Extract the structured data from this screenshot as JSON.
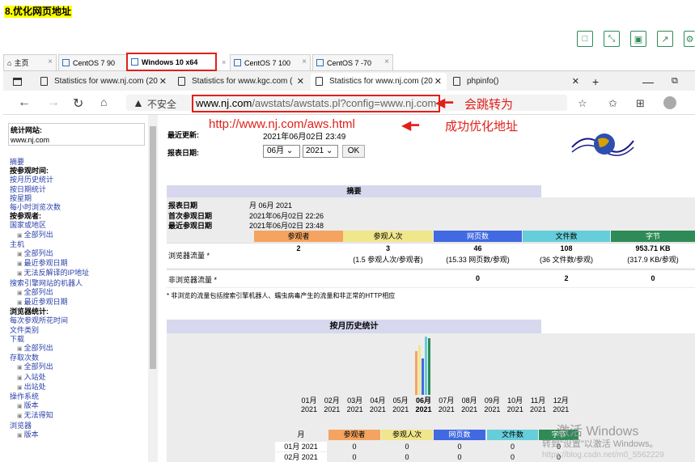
{
  "heading": "8.优化网页地址",
  "toolbar_icons": [
    "square-icon",
    "expand-icon",
    "save-icon",
    "share-icon",
    "settings-icon"
  ],
  "vm_tabs": [
    {
      "label": "主页"
    },
    {
      "label": "CentOS 7 90"
    },
    {
      "label": "Windows 10 x64"
    },
    {
      "label": "CentOS 7 100"
    },
    {
      "label": "CentOS 7 -70"
    }
  ],
  "browser_tabs": [
    {
      "label": "Statistics for www.nj.com (20"
    },
    {
      "label": "Statistics for www.kgc.com ("
    },
    {
      "label": "Statistics for www.nj.com (20"
    },
    {
      "label": "phpinfo()"
    }
  ],
  "address": {
    "security": "不安全",
    "domain": "www.nj.com",
    "path": "/awstats/awstats.pl?config=www.nj.com"
  },
  "annotations": {
    "redirect_note": "会跳转为",
    "new_url": "http://www.nj.com/aws.html",
    "success_note": "成功优化地址"
  },
  "sidebar": {
    "site_label": "统计网站:",
    "site_value": "www.nj.com",
    "items": [
      {
        "text": "摘要",
        "t": "lk"
      },
      {
        "text": "按参观时间:",
        "t": "h"
      },
      {
        "text": "按月历史统计",
        "t": "lk"
      },
      {
        "text": "按日期统计",
        "t": "lk"
      },
      {
        "text": "按星期",
        "t": "lk"
      },
      {
        "text": "每小时浏览次数",
        "t": "lk"
      },
      {
        "text": "按参观者:",
        "t": "h"
      },
      {
        "text": "国家或地区",
        "t": "lk"
      },
      {
        "text": "全部列出",
        "t": "sub"
      },
      {
        "text": "主机",
        "t": "lk"
      },
      {
        "text": "全部列出",
        "t": "sub"
      },
      {
        "text": "最近参观日期",
        "t": "sub"
      },
      {
        "text": "无法反解译的IP地址",
        "t": "sub"
      },
      {
        "text": "搜索引擎网站的机器人",
        "t": "lk"
      },
      {
        "text": "全部列出",
        "t": "sub"
      },
      {
        "text": "最近参观日期",
        "t": "sub"
      },
      {
        "text": "浏览器统计:",
        "t": "h"
      },
      {
        "text": "每次参观所花时间",
        "t": "lk"
      },
      {
        "text": "文件类别",
        "t": "lk"
      },
      {
        "text": "下载",
        "t": "lk"
      },
      {
        "text": "全部列出",
        "t": "sub"
      },
      {
        "text": "存取次数",
        "t": "lk"
      },
      {
        "text": "全部列出",
        "t": "sub"
      },
      {
        "text": "入站处",
        "t": "sub"
      },
      {
        "text": "出站处",
        "t": "sub"
      },
      {
        "text": "操作系统",
        "t": "lk"
      },
      {
        "text": "版本",
        "t": "sub"
      },
      {
        "text": "无法得知",
        "t": "sub"
      },
      {
        "text": "浏览器",
        "t": "lk"
      },
      {
        "text": "版本",
        "t": "sub"
      }
    ]
  },
  "header": {
    "last_update_label": "最近更新:",
    "last_update_value": "2021年06月02日 23:49",
    "report_date_label": "报表日期:",
    "month_select": "06月",
    "year_select": "2021",
    "ok_button": "OK"
  },
  "summary": {
    "title": "摘要",
    "report_date_label": "报表日期",
    "report_date_value": "月 06月 2021",
    "first_visit_label": "首次参观日期",
    "first_visit_value": "2021年06月02日 22:26",
    "last_visit_label": "最近参观日期",
    "last_visit_value": "2021年06月02日 23:48",
    "columns": [
      "参观者",
      "参观人次",
      "网页数",
      "文件数",
      "字节"
    ],
    "column_colors": [
      "#f4a460",
      "#f0e68c",
      "#4169e1",
      "#66cdda",
      "#2e8b57"
    ],
    "rows": [
      {
        "label": "浏览器流量 *",
        "values": [
          "2",
          "3",
          "46",
          "108",
          "953.71 KB"
        ],
        "subs": [
          "",
          "(1.5 参观人次/参观者)",
          "(15.33 网页数/参观)",
          "(36 文件数/参观)",
          "(317.9 KB/参观)"
        ]
      },
      {
        "label": "非浏览器流量 *",
        "values": [
          "",
          "",
          "0",
          "2",
          "0"
        ],
        "subs": [
          "",
          "",
          "",
          "",
          ""
        ]
      }
    ],
    "footnote": "* 非浏览的流量包括搜索引擎机器人、蠕虫病毒产生的流量和非正常的HTTP相应"
  },
  "monthly": {
    "title": "按月历史统计",
    "months": [
      "01月",
      "02月",
      "03月",
      "04月",
      "05月",
      "06月",
      "07月",
      "08月",
      "09月",
      "10月",
      "11月",
      "12月"
    ],
    "years": [
      "2021",
      "2021",
      "2021",
      "2021",
      "2021",
      "2021",
      "2021",
      "2021",
      "2021",
      "2021",
      "2021",
      "2021"
    ],
    "current_month_index": 5,
    "bars_june": {
      "visitors": 2,
      "visits": 3,
      "pages": 46,
      "hits": 108,
      "bandwidth_kb": 953.71
    },
    "table_columns": [
      "月",
      "参观者",
      "参观人次",
      "网页数",
      "文件数",
      "字节"
    ],
    "table_rows": [
      [
        "01月 2021",
        "0",
        "0",
        "0",
        "0",
        "0"
      ],
      [
        "02月 2021",
        "0",
        "0",
        "0",
        "0",
        "0"
      ]
    ]
  },
  "watermark": {
    "line1": "激活 Windows",
    "line2": "转到\"设置\"以激活 Windows。",
    "source": "https://blog.csdn.net/m0_5562229"
  }
}
